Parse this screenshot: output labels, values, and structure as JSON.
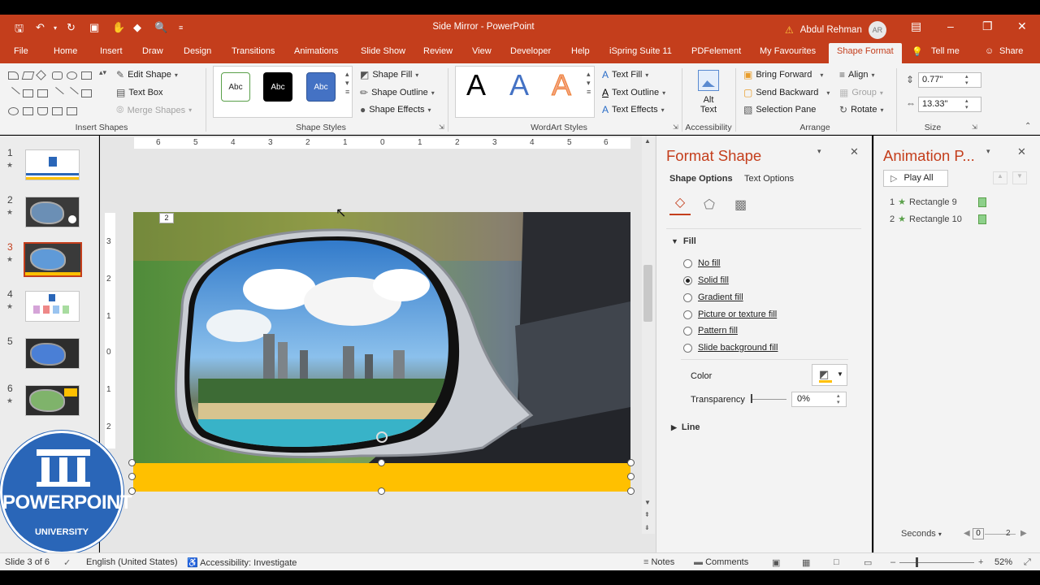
{
  "window": {
    "title": "Side Mirror  -  PowerPoint",
    "user_name": "Abdul Rehman",
    "user_initials": "AR"
  },
  "tabs": [
    "File",
    "Home",
    "Insert",
    "Draw",
    "Design",
    "Transitions",
    "Animations",
    "Slide Show",
    "Review",
    "View",
    "Developer",
    "Help",
    "iSpring Suite 11",
    "PDFelement",
    "My Favourites",
    "Shape Format",
    "Tell me",
    "Share"
  ],
  "active_tab": "Shape Format",
  "ribbon": {
    "insert_shapes": {
      "label": "Insert Shapes",
      "edit_shape": "Edit Shape",
      "text_box": "Text Box",
      "merge_shapes": "Merge Shapes"
    },
    "shape_styles": {
      "label": "Shape Styles",
      "style_text": "Abc",
      "shape_fill": "Shape Fill",
      "shape_outline": "Shape Outline",
      "shape_effects": "Shape Effects"
    },
    "wordart_styles": {
      "label": "WordArt Styles",
      "letter": "A",
      "text_fill": "Text Fill",
      "text_outline": "Text Outline",
      "text_effects": "Text Effects"
    },
    "accessibility": {
      "label": "Accessibility",
      "alt_text_1": "Alt",
      "alt_text_2": "Text"
    },
    "arrange": {
      "label": "Arrange",
      "bring_forward": "Bring Forward",
      "send_backward": "Send Backward",
      "selection_pane": "Selection Pane",
      "align": "Align",
      "group": "Group",
      "rotate": "Rotate"
    },
    "size": {
      "label": "Size",
      "height": "0.77\"",
      "width": "13.33\""
    }
  },
  "slides": [
    {
      "number": "1",
      "star": "★"
    },
    {
      "number": "2",
      "star": "★"
    },
    {
      "number": "3",
      "star": "★"
    },
    {
      "number": "4",
      "star": "★"
    },
    {
      "number": "5",
      "star": ""
    },
    {
      "number": "6",
      "star": "★"
    }
  ],
  "selected_slide": "3",
  "ruler": {
    "horizontal": [
      "6",
      "5",
      "4",
      "3",
      "2",
      "1",
      "0",
      "1",
      "2",
      "3",
      "4",
      "5",
      "6"
    ],
    "vertical": [
      "3",
      "2",
      "1",
      "0",
      "1",
      "2",
      "3"
    ]
  },
  "slide_badge": "2",
  "format_pane": {
    "title": "Format Shape",
    "tab_shape_options": "Shape Options",
    "tab_text_options": "Text Options",
    "fill_section": "Fill",
    "fill_options": [
      "No fill",
      "Solid fill",
      "Gradient fill",
      "Picture or texture fill",
      "Pattern fill",
      "Slide background fill"
    ],
    "selected_fill": "Solid fill",
    "color_label": "Color",
    "transparency_label": "Transparency",
    "transparency_value": "0%",
    "line_section": "Line",
    "bar_color": "#ffc000"
  },
  "animation_pane": {
    "title": "Animation P...",
    "play_all": "Play All",
    "items": [
      {
        "number": "1",
        "name": "Rectangle 9"
      },
      {
        "number": "2",
        "name": "Rectangle 10"
      }
    ],
    "seconds_label": "Seconds",
    "timeline_start": "0",
    "timeline_end": "2"
  },
  "status": {
    "slide_of": "Slide 3 of 6",
    "language": "English (United States)",
    "accessibility": "Accessibility: Investigate",
    "notes": "Notes",
    "comments": "Comments",
    "zoom": "52%"
  },
  "logo": {
    "line1": "POWERPOINT",
    "line2": "UNIVERSITY"
  },
  "colors": {
    "accent": "#c43e1c",
    "selected_shape_fill": "#ffc000"
  }
}
